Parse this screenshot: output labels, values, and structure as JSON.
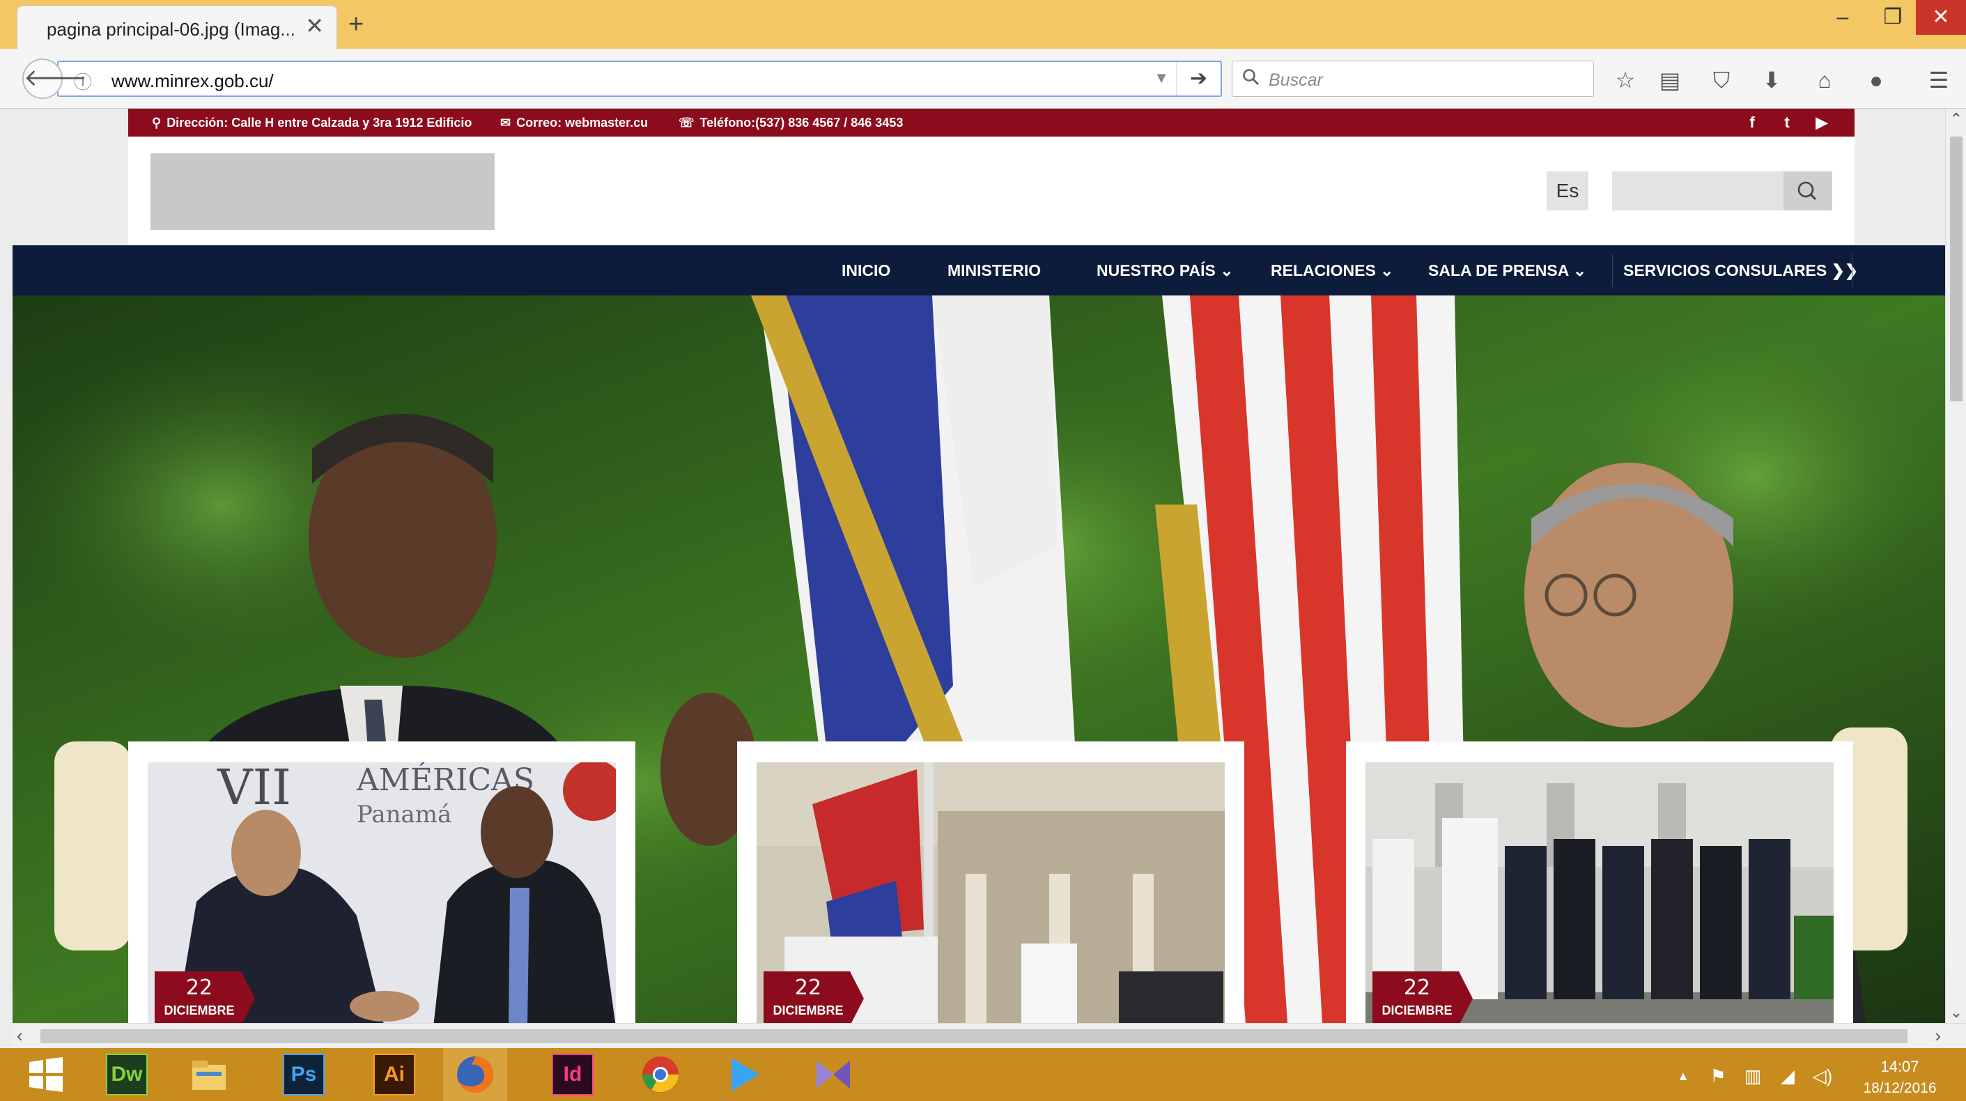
{
  "browser": {
    "tab_title": "pagina principal-06.jpg (Imag...",
    "tab_close": "✕",
    "new_tab": "+",
    "url": "www.minrex.gob.cu/",
    "search_placeholder": "Buscar",
    "window": {
      "minimize": "–",
      "maximize": "❐",
      "close": "✕"
    }
  },
  "topbar": {
    "address": "Dirección: Calle H entre Calzada y 3ra 1912 Edificio",
    "email": "Correo: webmaster.cu",
    "phone": "Teléfono:(537) 836 4567 / 846 3453",
    "social": [
      "f",
      "t",
      "▶"
    ]
  },
  "header": {
    "language": "Es"
  },
  "nav": {
    "items": [
      {
        "label": "INICIO"
      },
      {
        "label": "MINISTERIO"
      },
      {
        "label": "NUESTRO PAÍS ⌄"
      },
      {
        "label": "RELACIONES ⌄"
      },
      {
        "label": "SALA DE PRENSA ⌄"
      },
      {
        "label": "SERVICIOS CONSULARES ❯❯"
      }
    ]
  },
  "cards": [
    {
      "day": "22",
      "month": "DICIEMBRE",
      "caption": "VII AMÉRICAS Panamá"
    },
    {
      "day": "22",
      "month": "DICIEMBRE"
    },
    {
      "day": "22",
      "month": "DICIEMBRE"
    }
  ],
  "taskbar": {
    "apps": [
      "Dw",
      "Ps",
      "Ai",
      "Id"
    ],
    "time": "14:07",
    "date": "18/12/2016"
  },
  "colors": {
    "topbar": "#8c0c1e",
    "nav": "#0c1c3a",
    "badge": "#8c0c1e",
    "taskbar": "#c88c1e"
  }
}
